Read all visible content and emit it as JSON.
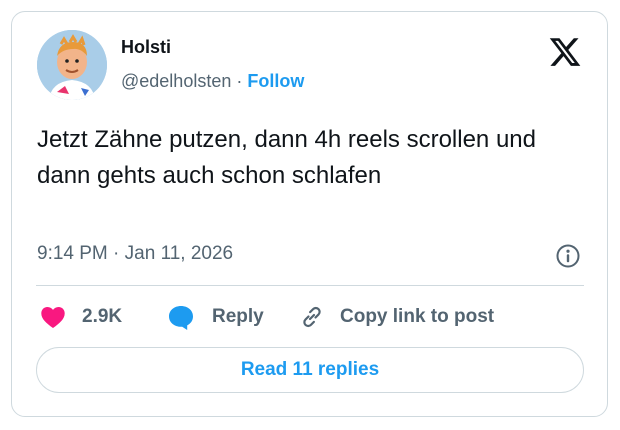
{
  "author": {
    "name": "Holsti",
    "handle": "@edelholsten",
    "separator": "·",
    "follow_label": "Follow"
  },
  "tweet": {
    "text": "Jetzt Zähne putzen, dann 4h reels scrollen und dann gehts auch schon schlafen",
    "time": "9:14 PM",
    "date_separator": "·",
    "date": "Jan 11, 2026"
  },
  "actions": {
    "like_count": "2.9K",
    "reply_label": "Reply",
    "copy_label": "Copy link to post"
  },
  "read_replies_label": "Read 11 replies",
  "icons": {
    "like": "heart-icon",
    "reply": "speech-bubble-icon",
    "copy": "link-icon",
    "info": "info-icon",
    "brand": "x-logo-icon"
  },
  "colors": {
    "accent": "#1d9bf0",
    "like": "#f91880",
    "text": "#0f1419",
    "muted": "#536471",
    "border": "#cfd9de"
  }
}
